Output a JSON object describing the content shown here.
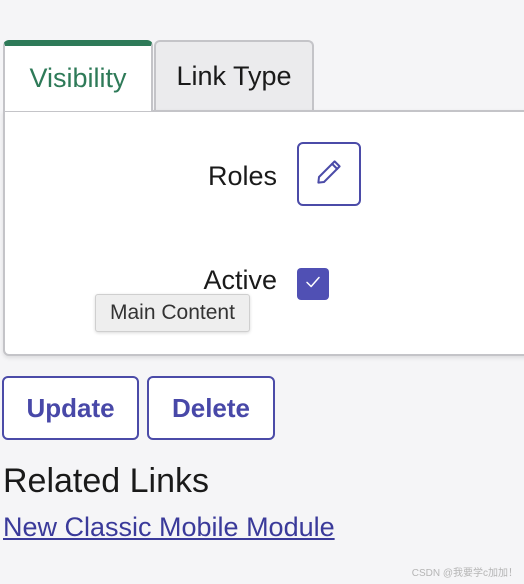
{
  "tabs": [
    {
      "label": "Visibility",
      "active": true
    },
    {
      "label": "Link Type",
      "active": false
    }
  ],
  "form": {
    "roles_label": "Roles",
    "active_label": "Active",
    "active_checked": true
  },
  "tooltip": {
    "text": "Main Content"
  },
  "actions": {
    "update_label": "Update",
    "delete_label": "Delete"
  },
  "related": {
    "heading": "Related Links",
    "links": [
      "New Classic Mobile Module"
    ]
  },
  "watermark": "CSDN @我要学c加加！",
  "colors": {
    "active_tab_accent": "#2e7a58",
    "primary": "#4b4ba8",
    "checkbox_fill": "#5050b4"
  },
  "icons": {
    "edit": "pencil-icon",
    "check": "check-icon"
  }
}
